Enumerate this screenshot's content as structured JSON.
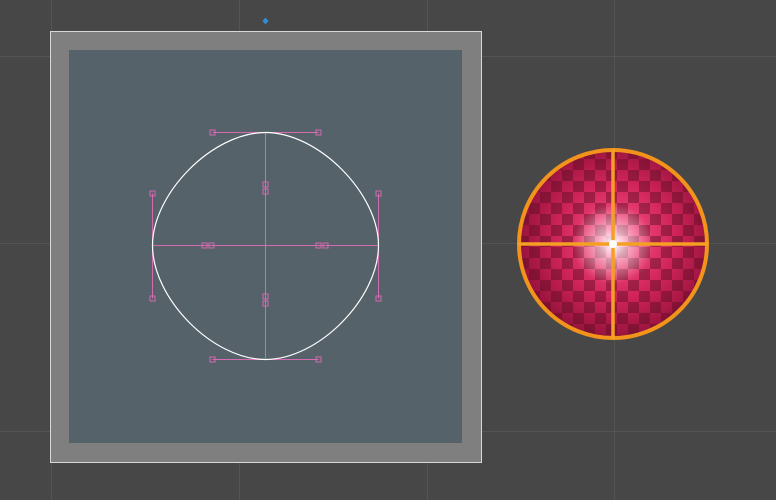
{
  "scene_view": {
    "background_color": "#474747",
    "grid_color": "#545454"
  },
  "pivot_marker": {
    "icon": "pivot-handle-icon",
    "color": "#2e8fd6"
  },
  "sprite_editor_panel": {
    "frame_color": "#7f7f7f",
    "frame_border_color": "#d8d8d8",
    "canvas_color": "#56626a"
  },
  "shape_outline": {
    "stroke_color": "#ffffff"
  },
  "bezier_handles": {
    "color": "#d46ab0",
    "icon": "tangent-handle-icon"
  },
  "sprite_preview": {
    "fill_colors": [
      "#ff5a8e",
      "#d0245a",
      "#8c0f37"
    ],
    "checker_color": "#5a0d24",
    "outline_color": "#f2941c",
    "crosshair_color": "#f5a023",
    "highlight_color": "#ffffff"
  }
}
